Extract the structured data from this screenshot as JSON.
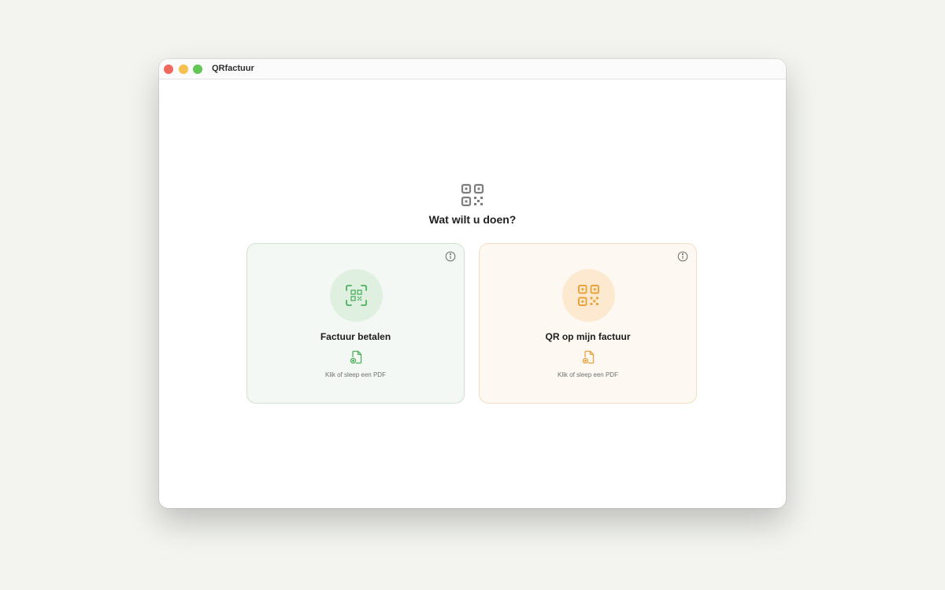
{
  "window": {
    "title": "QRfactuur"
  },
  "main": {
    "hero_icon": "qr-code-icon",
    "heading": "Wat wilt u doen?"
  },
  "cards": [
    {
      "title": "Factuur betalen",
      "hint": "Klik of sleep een PDF",
      "icon": "qr-scan-icon",
      "file_icon": "file-add-icon",
      "info_icon": "info-icon",
      "accent": "#4caf5c"
    },
    {
      "title": "QR op mijn factuur",
      "hint": "Klik of sleep een PDF",
      "icon": "qr-code-icon",
      "file_icon": "file-add-icon",
      "info_icon": "info-icon",
      "accent": "#e9a23b"
    }
  ]
}
